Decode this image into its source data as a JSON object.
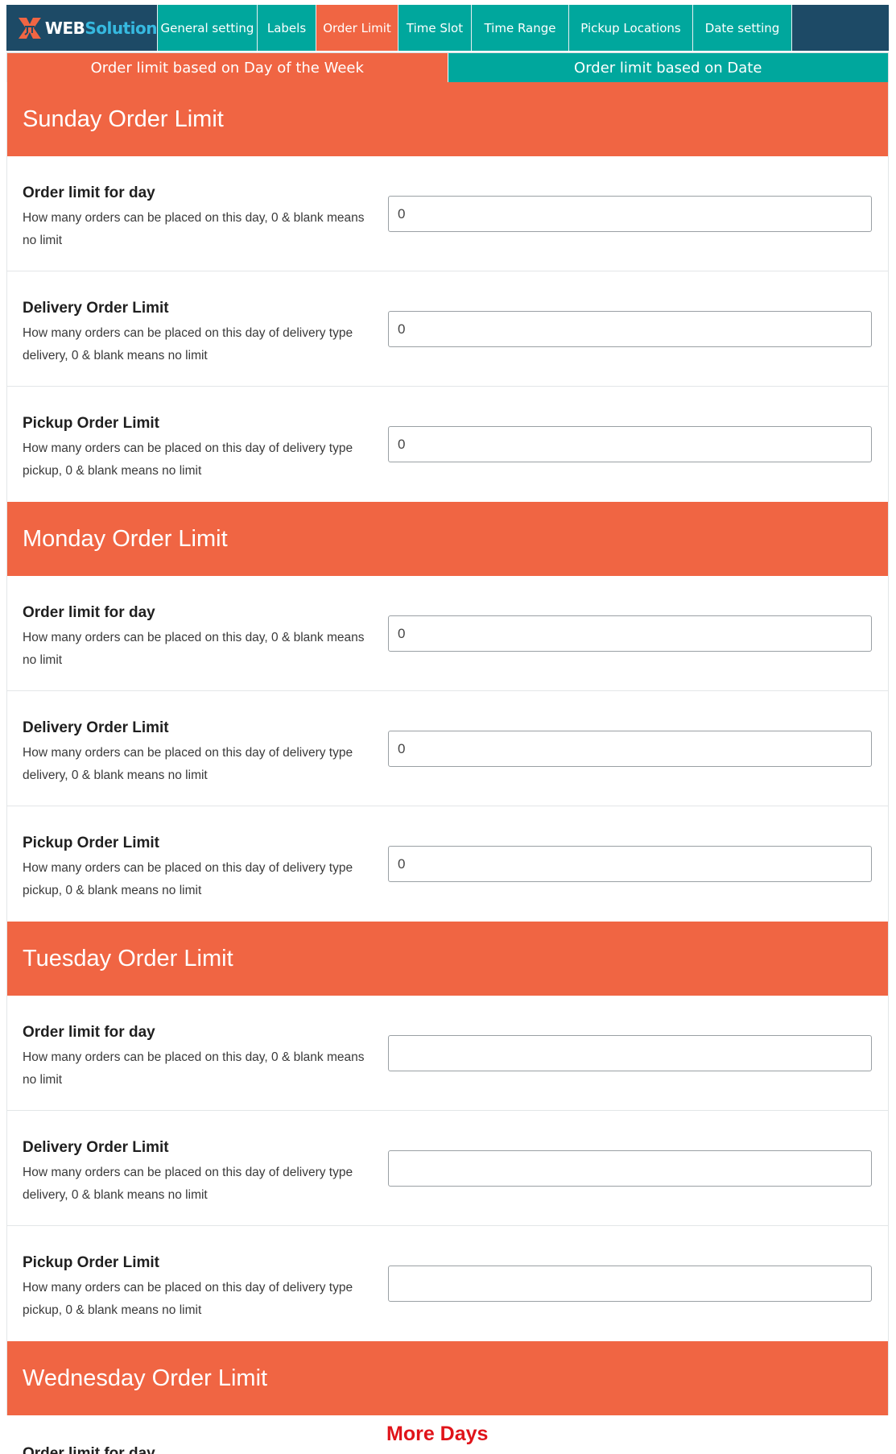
{
  "brand": {
    "logo_web": "WEB",
    "logo_solution": "Solution"
  },
  "nav": {
    "tabs": [
      {
        "label": "General setting"
      },
      {
        "label": "Labels"
      },
      {
        "label": "Order Limit"
      },
      {
        "label": "Time Slot"
      },
      {
        "label": "Time Range"
      },
      {
        "label": "Pickup Locations"
      },
      {
        "label": "Date setting"
      }
    ]
  },
  "subtabs": {
    "by_weekday": "Order limit based on Day of the Week",
    "by_date": "Order limit based on Date"
  },
  "fields": {
    "order_day_label": "Order limit for day",
    "order_day_desc": "How many orders can be placed on this day, 0 & blank means no limit",
    "delivery_label": "Delivery Order Limit",
    "delivery_desc": "How many orders can be placed on this day of delivery type delivery, 0 & blank means no limit",
    "pickup_label": "Pickup Order Limit",
    "pickup_desc": "How many orders can be placed on this day of delivery type pickup, 0 & blank means no limit"
  },
  "days": [
    {
      "title": "Sunday Order Limit",
      "order_day_value": "0",
      "delivery_value": "0",
      "pickup_value": "0"
    },
    {
      "title": "Monday Order Limit",
      "order_day_value": "0",
      "delivery_value": "0",
      "pickup_value": "0"
    },
    {
      "title": "Tuesday Order Limit",
      "order_day_value": "",
      "delivery_value": "",
      "pickup_value": ""
    },
    {
      "title": "Wednesday Order Limit"
    }
  ],
  "annotation": {
    "more_days": "More Days"
  },
  "colors": {
    "nav_bg": "#1d4a66",
    "teal": "#00a79d",
    "orange": "#f06543",
    "annotation_red": "#e0141a"
  }
}
